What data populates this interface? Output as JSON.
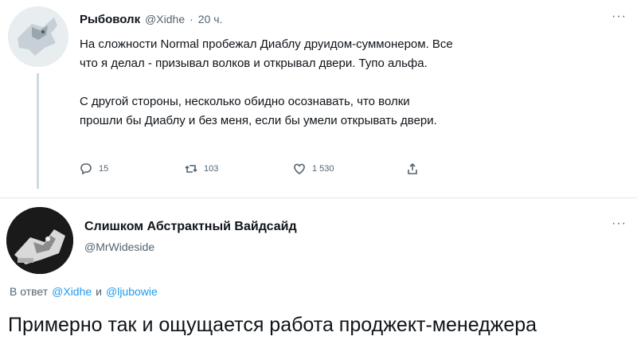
{
  "tweet1": {
    "display_name": "Рыбоволк",
    "handle": "@Xidhe",
    "separator": "·",
    "time": "20 ч.",
    "more": "···",
    "paragraph1_line1": "На сложности Normal пробежал Диаблу друидом-суммонером. Все",
    "paragraph1_line2": "что я делал - призывал волков и открывал двери. Тупо альфа.",
    "paragraph2_line1": "С другой стороны, несколько обидно осознавать, что волки",
    "paragraph2_line2": "прошли бы Диаблу и без меня, если бы умели открывать двери.",
    "actions": {
      "replies": "15",
      "retweets": "103",
      "likes": "1 530"
    }
  },
  "tweet2": {
    "display_name": "Слишком Абстрактный Вайдсайд",
    "handle": "@MrWideside",
    "more": "···",
    "replying_prefix": "В ответ",
    "replying_user1": "@Xidhe",
    "replying_and": "и",
    "replying_user2": "@ljubowie",
    "text": "Примерно так и ощущается работа проджект-менеджера"
  },
  "colors": {
    "link": "#1d9bf0",
    "text": "#0f1419",
    "muted": "#536471",
    "divider": "#e1e6ea"
  },
  "icons": [
    "reply-icon",
    "retweet-icon",
    "like-icon",
    "share-icon",
    "more-icon"
  ]
}
